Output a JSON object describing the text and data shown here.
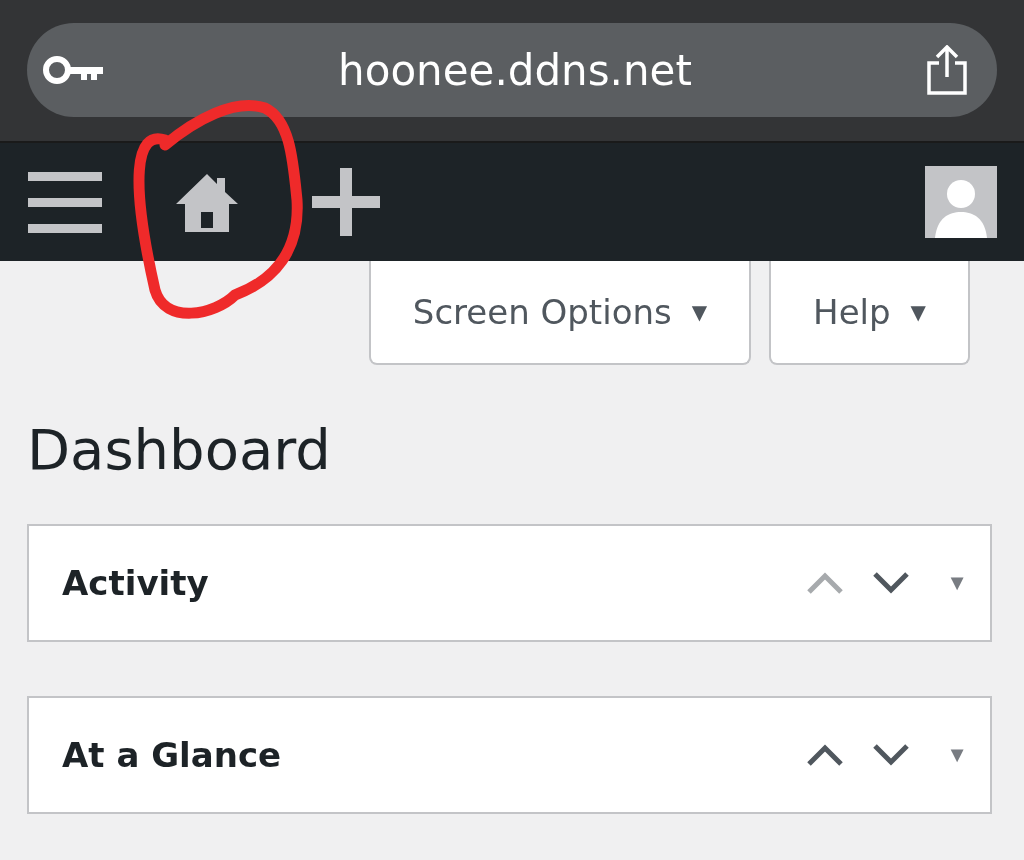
{
  "browser": {
    "url": "hoonee.ddns.net"
  },
  "screen_options": [
    {
      "label": "Screen Options",
      "caret": "▼"
    },
    {
      "label": "Help",
      "caret": "▼"
    }
  ],
  "page_title": "Dashboard",
  "panels": [
    {
      "title": "Activity",
      "up_disabled": true,
      "toggle": "▼"
    },
    {
      "title": "At a Glance",
      "up_disabled": false,
      "toggle": "▼"
    }
  ]
}
